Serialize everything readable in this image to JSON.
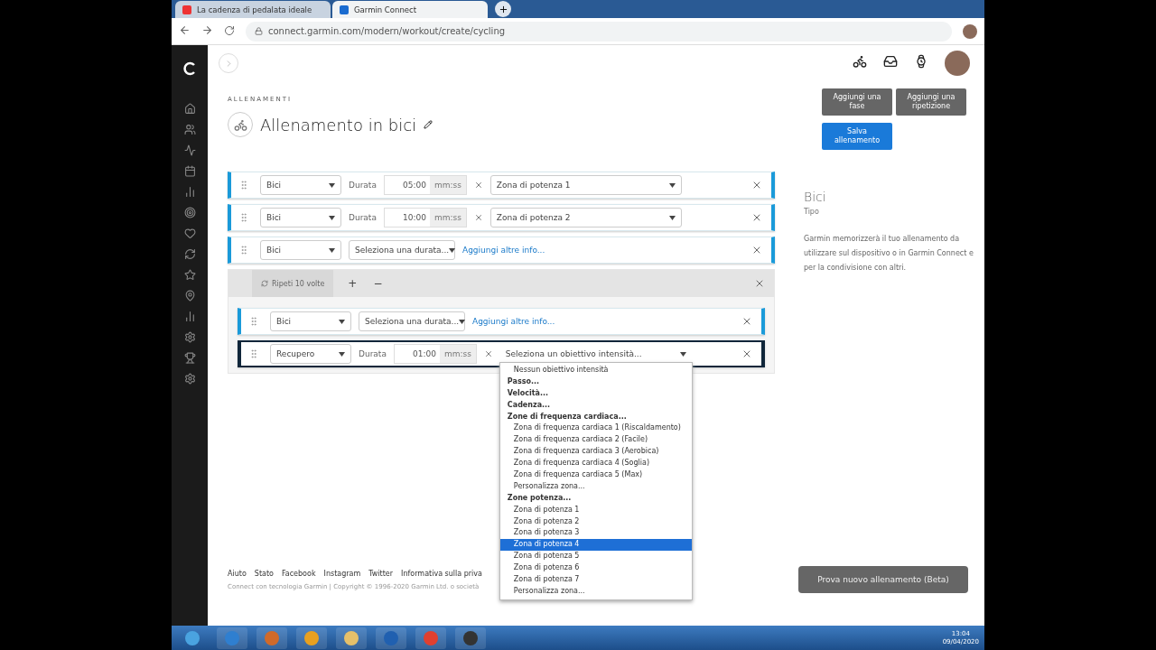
{
  "browser": {
    "tabs": [
      {
        "title": "La cadenza di pedalata ideale",
        "selected": false
      },
      {
        "title": "Garmin Connect",
        "selected": true
      }
    ],
    "url": "connect.garmin.com/modern/workout/create/cycling"
  },
  "breadcrumb": "ALLENAMENTI",
  "title": "Allenamento in bici",
  "steps": [
    {
      "kind": "step",
      "active": false,
      "type": "Bici",
      "duration_label": "Durata",
      "duration": "05:00",
      "unit": "mm:ss",
      "target": "Zona di potenza 1"
    },
    {
      "kind": "step",
      "active": false,
      "type": "Bici",
      "duration_label": "Durata",
      "duration": "10:00",
      "unit": "mm:ss",
      "target": "Zona di potenza 2"
    },
    {
      "kind": "empty",
      "active": false,
      "type": "Bici",
      "duration_placeholder": "Seleziona una durata...",
      "link": "Aggiungi altre info..."
    },
    {
      "kind": "repeat",
      "label": "Ripeti 10 volte",
      "add": "+",
      "remove": "−",
      "children": [
        {
          "kind": "empty",
          "active": false,
          "type": "Bici",
          "duration_placeholder": "Seleziona una durata...",
          "link": "Aggiungi altre info..."
        },
        {
          "kind": "step",
          "active": true,
          "type": "Recupero",
          "duration_label": "Durata",
          "duration": "01:00",
          "unit": "mm:ss",
          "target": "Seleziona un obiettivo intensità..."
        }
      ]
    }
  ],
  "dropdown": {
    "options": [
      {
        "kind": "option",
        "label": "Nessun obiettivo intensità",
        "selected": false
      },
      {
        "kind": "group",
        "label": "Passo...",
        "selected": false
      },
      {
        "kind": "group",
        "label": "Velocità...",
        "selected": false
      },
      {
        "kind": "group",
        "label": "Cadenza...",
        "selected": false
      },
      {
        "kind": "group",
        "label": "Zone di frequenza cardiaca...",
        "selected": false
      },
      {
        "kind": "option",
        "label": "Zona di frequenza cardiaca 1 (Riscaldamento)",
        "selected": false
      },
      {
        "kind": "option",
        "label": "Zona di frequenza cardiaca 2 (Facile)",
        "selected": false
      },
      {
        "kind": "option",
        "label": "Zona di frequenza cardiaca 3 (Aerobica)",
        "selected": false
      },
      {
        "kind": "option",
        "label": "Zona di frequenza cardiaca 4 (Soglia)",
        "selected": false
      },
      {
        "kind": "option",
        "label": "Zona di frequenza cardiaca 5 (Max)",
        "selected": false
      },
      {
        "kind": "option",
        "label": "Personalizza zona...",
        "selected": false
      },
      {
        "kind": "group",
        "label": "Zone potenza...",
        "selected": false
      },
      {
        "kind": "option",
        "label": "Zona di potenza 1",
        "selected": false
      },
      {
        "kind": "option",
        "label": "Zona di potenza 2",
        "selected": false
      },
      {
        "kind": "option",
        "label": "Zona di potenza 3",
        "selected": false
      },
      {
        "kind": "option",
        "label": "Zona di potenza 4",
        "selected": true
      },
      {
        "kind": "option",
        "label": "Zona di potenza 5",
        "selected": false
      },
      {
        "kind": "option",
        "label": "Zona di potenza 6",
        "selected": false
      },
      {
        "kind": "option",
        "label": "Zona di potenza 7",
        "selected": false
      },
      {
        "kind": "option",
        "label": "Personalizza zona...",
        "selected": false
      }
    ]
  },
  "actions": [
    {
      "kind": "secondary",
      "label": "Aggiungi una fase"
    },
    {
      "kind": "secondary",
      "label": "Aggiungi una ripetizione"
    },
    {
      "kind": "primary",
      "label": "Salva allenamento"
    }
  ],
  "sport": {
    "name": "Bici",
    "label": "Tipo",
    "description": "Garmin memorizzerà il tuo allenamento da utilizzare sul dispositivo o in Garmin Connect e per la condivisione con altri."
  },
  "footer": {
    "links": [
      "Aiuto",
      "Stato",
      "Facebook",
      "Instagram",
      "Twitter",
      "Informativa sulla priva"
    ],
    "copyright": "Connect con tecnologia Garmin | Copyright © 1996-2020 Garmin Ltd. o società",
    "beta_button": "Prova nuovo allenamento (Beta)"
  },
  "taskbar": {
    "time": "13:04",
    "date": "09/04/2020"
  }
}
